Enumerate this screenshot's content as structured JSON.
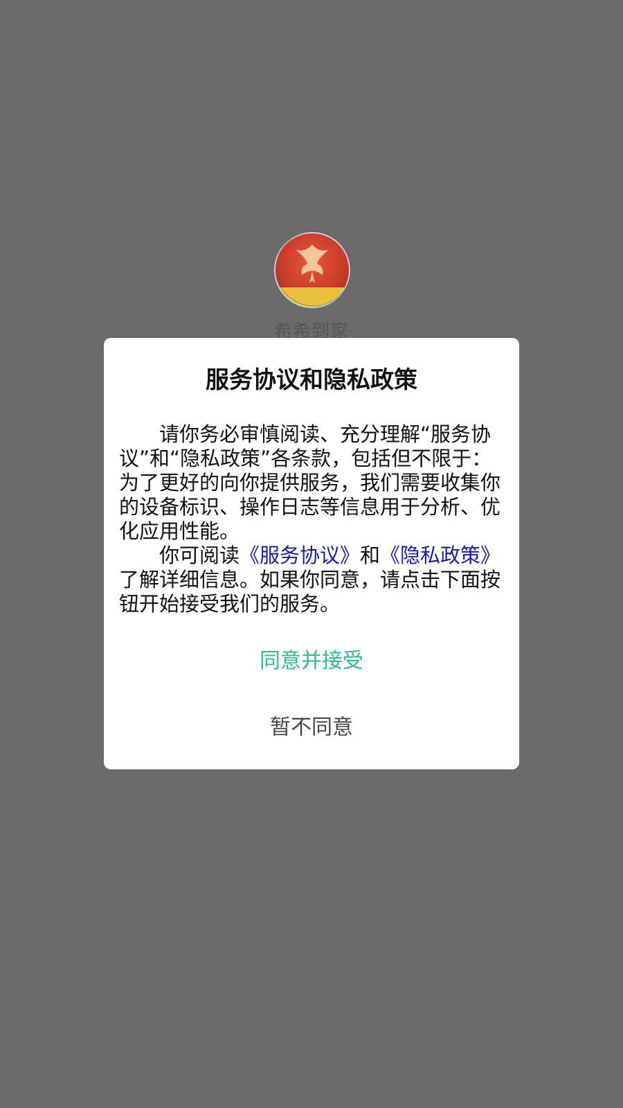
{
  "splash": {
    "app_name": "希希到家",
    "logo_text": "希 希 到 家"
  },
  "dialog": {
    "title": "服务协议和隐私政策",
    "paragraph1": "请你务必审慎阅读、充分理解“服务协议”和“隐私政策”各条款，包括但不限于：为了更好的向你提供服务，我们需要收集你的设备标识、操作日志等信息用于分析、优化应用性能。",
    "paragraph2_prefix": "你可阅读",
    "service_agreement_link": "《服务协议》",
    "paragraph2_and": "和",
    "privacy_policy_link": "《隐私政策》",
    "paragraph2_suffix": "了解详细信息。如果你同意，请点击下面按钮开始接受我们的服务。",
    "agree_label": "同意并接受",
    "disagree_label": "暂不同意"
  },
  "colors": {
    "overlay": "#6b6b6b",
    "link": "#1a1aa6",
    "agree": "#2fb894",
    "disagree": "#444444"
  }
}
